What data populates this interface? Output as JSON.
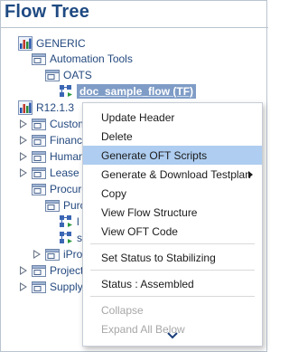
{
  "title": "Flow Tree",
  "tree": {
    "generic": "GENERIC",
    "automation_tools": "Automation Tools",
    "oats": "OATS",
    "doc_sample_flow": "doc_sample_flow (TF)",
    "r12": "R12.1.3",
    "customer": "Custom",
    "financials": "Financia",
    "human": "Human",
    "lease": "Lease",
    "procure": "Procure",
    "purch": "Purc",
    "flow_l": "l",
    "flow_s": "s",
    "iproc": "iProc",
    "projects": "Projects",
    "supply": "Supply"
  },
  "menu": {
    "update_header": "Update Header",
    "delete": "Delete",
    "generate_oft": "Generate OFT Scripts",
    "generate_download": "Generate & Download Testplan",
    "copy": "Copy",
    "view_flow_structure": "View Flow Structure",
    "view_oft_code": "View OFT Code",
    "set_status": "Set Status to Stabilizing",
    "status": "Status : Assembled",
    "collapse": "Collapse",
    "expand_all_below": "Expand All Below"
  },
  "colors": {
    "title": "#1e4a82",
    "tree_text": "#24497f",
    "selected_bg": "#7f9cc6",
    "menu_highlight": "#aecdf0",
    "disabled": "#a7a7a7"
  },
  "icons": {
    "library": "chart-library-icon",
    "folder": "sub-folder-icon",
    "flow": "flow-node-icon"
  }
}
